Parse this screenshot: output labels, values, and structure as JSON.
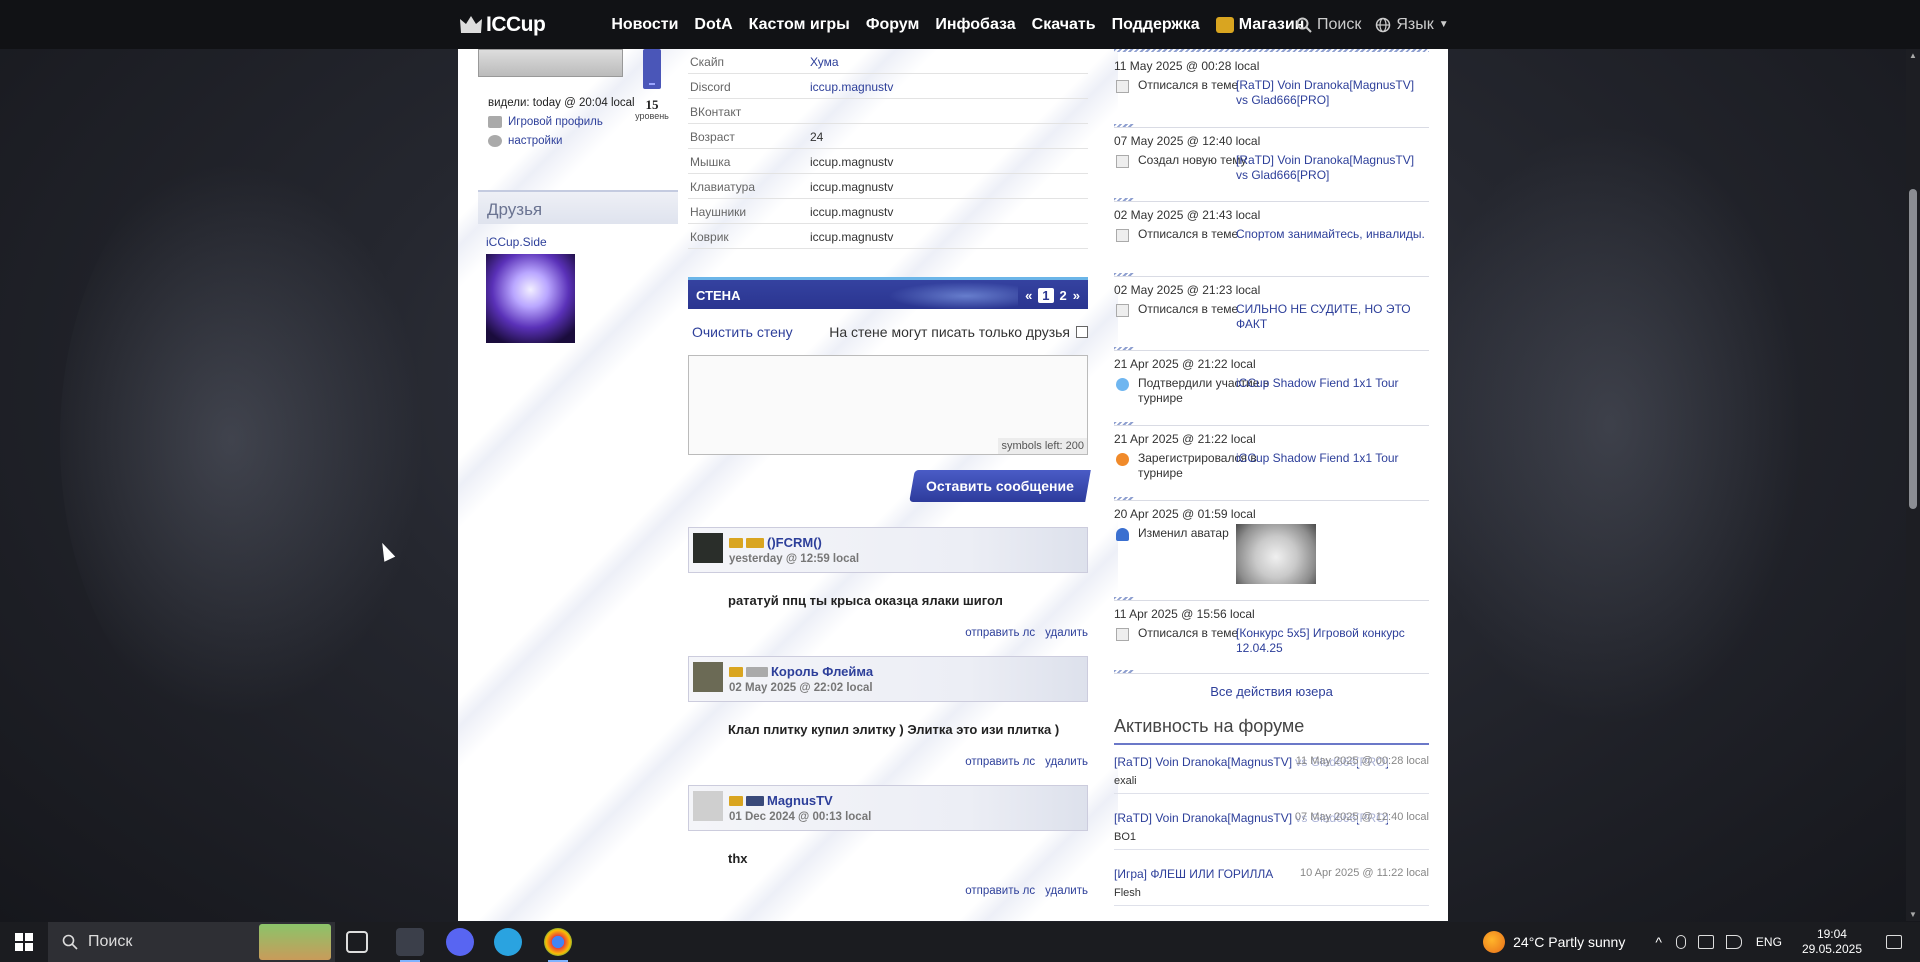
{
  "nav": {
    "logo": "ICCup",
    "links": [
      "Новости",
      "DotA",
      "Кастом игры",
      "Форум",
      "Инфобаза",
      "Скачать",
      "Поддержка"
    ],
    "shop": "Магазин",
    "search": "Поиск",
    "lang": "Язык"
  },
  "profile": {
    "seen": "видели: today @ 20:04 local",
    "level": "15",
    "level_word": "уровень",
    "game_profile": "Игровой профиль",
    "settings": "настройки",
    "friends_title": "Друзья",
    "friend_name": "iCCup.Side"
  },
  "info": [
    {
      "k": "Скайп",
      "v": "Хума",
      "link": true
    },
    {
      "k": "Discord",
      "v": "iccup.magnustv",
      "link": true
    },
    {
      "k": "ВКонтакт",
      "v": "",
      "link": false
    },
    {
      "k": "Возраст",
      "v": "24",
      "link": false
    },
    {
      "k": "Мышка",
      "v": "iccup.magnustv",
      "link": false
    },
    {
      "k": "Клавиатура",
      "v": "iccup.magnustv",
      "link": false
    },
    {
      "k": "Наушники",
      "v": "iccup.magnustv",
      "link": false
    },
    {
      "k": "Коврик",
      "v": "iccup.magnustv",
      "link": false
    }
  ],
  "wall": {
    "title": "СТЕНА",
    "pager_prev": "«",
    "pages": [
      "1",
      "2"
    ],
    "pager_next": "»",
    "clear": "Очистить стену",
    "friends_only": "На стене могут писать только друзья",
    "symbols_left": "symbols left: 200",
    "post_button": "Оставить сообщение",
    "posts": [
      {
        "name": "()FCRM()",
        "time": "yesterday @ 12:59 local",
        "text": "рататуй ппц ты крыса оказца ялаки шигол",
        "pm": "отправить лс",
        "del": "удалить"
      },
      {
        "name": "Король Флейма",
        "time": "02 May 2025 @ 22:02 local",
        "text": "Клал плитку купил элитку ) Элитка это изи плитка )",
        "pm": "отправить лс",
        "del": "удалить"
      },
      {
        "name": "MagnusTV",
        "time": "01 Dec 2024 @ 00:13 local",
        "text": "thx",
        "pm": "отправить лс",
        "del": "удалить"
      }
    ]
  },
  "activity": [
    {
      "date": "11 May 2025 @ 00:28 local",
      "what": "Отписался в теме",
      "target": "[RaTD] Voin Dranoka[MagnusTV] vs Glad666[PRO]",
      "icon": "post-icon"
    },
    {
      "date": "07 May 2025 @ 12:40 local",
      "what": "Создал новую тему",
      "target": "[RaTD] Voin Dranoka[MagnusTV] vs Glad666[PRO]",
      "icon": "new-topic-icon"
    },
    {
      "date": "02 May 2025 @ 21:43 local",
      "what": "Отписался в теме",
      "target": "Спортом занимайтесь, инвалиды.",
      "icon": "post-icon"
    },
    {
      "date": "02 May 2025 @ 21:23 local",
      "what": "Отписался в теме",
      "target": "СИЛЬНО НЕ СУДИТЕ, НО ЭТО ФАКТ",
      "icon": "post-icon"
    },
    {
      "date": "21 Apr 2025 @ 21:22 local",
      "what": "Подтвердили участие в турнире",
      "target": "iCCup Shadow Fiend 1x1 Tour",
      "icon": "confirm-icon"
    },
    {
      "date": "21 Apr 2025 @ 21:22 local",
      "what": "Зарегистрировался в турнире",
      "target": "iCCup Shadow Fiend 1x1 Tour",
      "icon": "register-icon"
    },
    {
      "date": "20 Apr 2025 @ 01:59 local",
      "what": "Изменил аватар",
      "target": "",
      "icon": "avatar-icon"
    },
    {
      "date": "11 Apr 2025 @ 15:56 local",
      "what": "Отписался в теме",
      "target": "[Конкурс 5x5] Игровой конкурс 12.04.25",
      "icon": "post-icon"
    }
  ],
  "all_actions": "Все действия юзера",
  "forum": {
    "title": "Активность на форуме",
    "rows": [
      {
        "t": "[RaTD] Voin Dranoka[MagnusTV] vs Glad666[PRO]",
        "d": "11 May 2025 @ 00:28 local",
        "u": "exali"
      },
      {
        "t": "[RaTD] Voin Dranoka[MagnusTV] vs Glad666[PRO]",
        "d": "07 May 2025 @ 12:40 local",
        "u": "BO1"
      },
      {
        "t": "[Игра] ФЛЕШ ИЛИ ГОРИЛЛА",
        "d": "10 Apr 2025 @ 11:22 local",
        "u": "Flesh"
      }
    ]
  },
  "taskbar": {
    "search": "Поиск",
    "weather": "24°C  Partly sunny",
    "lang": "ENG",
    "time": "19:04",
    "date": "29.05.2025"
  }
}
